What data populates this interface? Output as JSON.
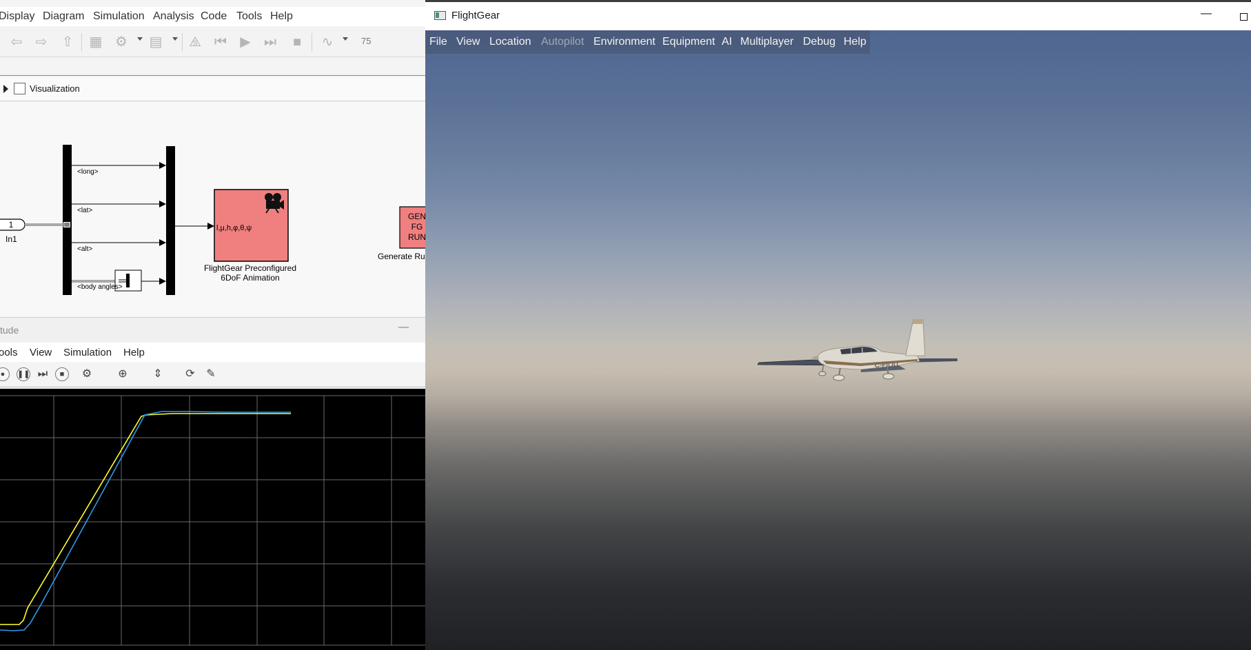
{
  "simulink": {
    "menu": [
      "Display",
      "Diagram",
      "Simulation",
      "Analysis",
      "Code",
      "Tools",
      "Help"
    ],
    "stop_time": "75",
    "breadcrumb": "Visualization",
    "diagram": {
      "inport_number": "1",
      "inport_label": "In1",
      "signals": [
        "<long>",
        "<lat>",
        "<alt>",
        "<body angles>"
      ],
      "fg_block_text": "l,μ,h,φ,θ,ψ",
      "fg_block_label_1": "FlightGear Preconfigured",
      "fg_block_label_2": "6DoF Animation",
      "gen_block_lines": [
        "GEN",
        "FG",
        "RUN"
      ],
      "gen_block_label": "Generate Ru"
    },
    "scope": {
      "title": "tude",
      "menu": [
        "ools",
        "View",
        "Simulation",
        "Help"
      ]
    }
  },
  "flightgear": {
    "title": "FlightGear",
    "menu": [
      "File",
      "View",
      "Location",
      "Autopilot",
      "Environment",
      "Equipment",
      "AI",
      "Multiplayer",
      "Debug",
      "Help"
    ],
    "disabled_menu": [
      "Autopilot"
    ],
    "aircraft_registration": "C-FIOU"
  },
  "colors": {
    "block_fill": "#f08080",
    "scope_yellow": "#ffff30",
    "scope_blue": "#2f9be8"
  }
}
